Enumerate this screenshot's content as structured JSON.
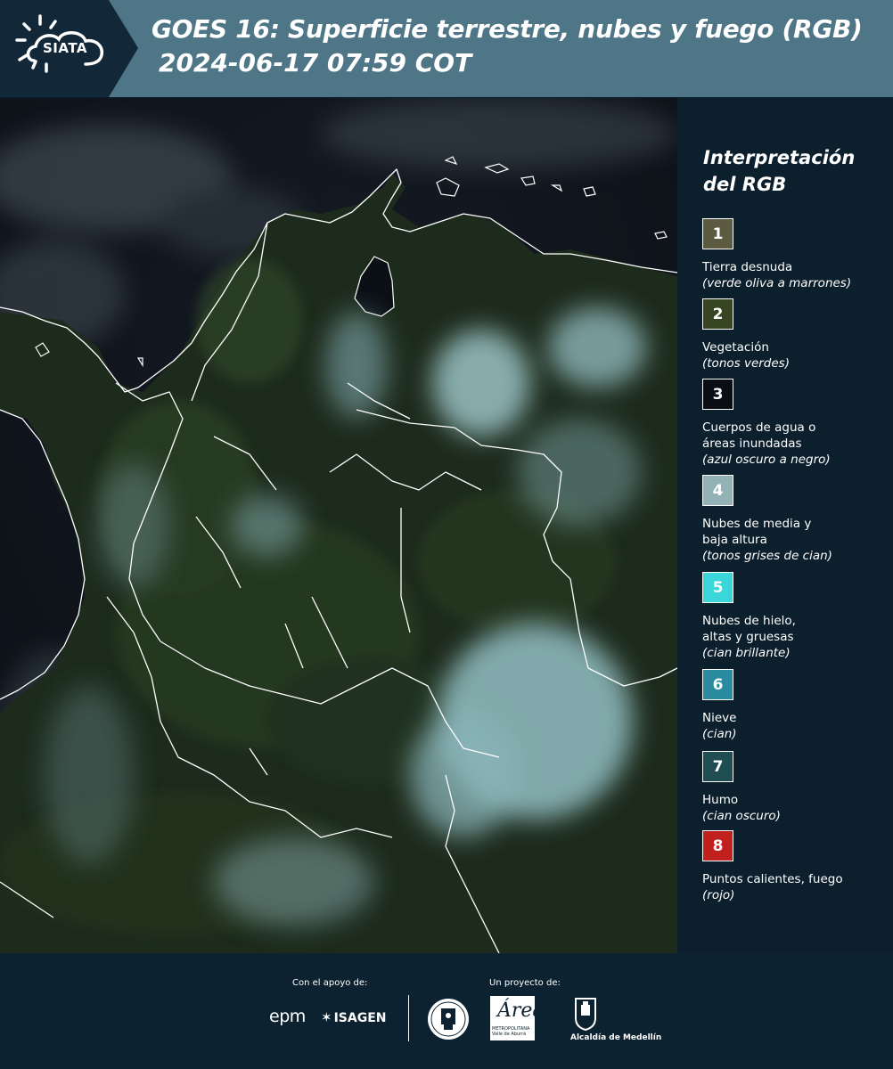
{
  "header": {
    "brand": "SIATA",
    "title": "GOES 16: Superficie terrestre, nubes y fuego (RGB)",
    "datetime": "2024-06-17 07:59 COT"
  },
  "legend": {
    "title": "Interpretación del RGB",
    "items": [
      {
        "number": "1",
        "label": "Tierra desnuda",
        "desc": "(verde oliva a marrones)",
        "color": "#5c5a41",
        "text_color": "#ffffff"
      },
      {
        "number": "2",
        "label": "Vegetación",
        "desc": "(tonos verdes)",
        "color": "#364522",
        "text_color": "#ffffff"
      },
      {
        "number": "3",
        "label": "Cuerpos de agua o áreas inundadas",
        "desc": "(azul oscuro a negro)",
        "color": "#0a0e14",
        "text_color": "#ffffff"
      },
      {
        "number": "4",
        "label": "Nubes de media y baja altura",
        "desc": "(tonos grises de cian)",
        "color": "#92b2b6",
        "text_color": "#ffffff"
      },
      {
        "number": "5",
        "label": "Nubes de hielo, altas y gruesas",
        "desc": "(cian brillante)",
        "color": "#3ad6d9",
        "text_color": "#ffffff"
      },
      {
        "number": "6",
        "label": "Nieve",
        "desc": "(cian)",
        "color": "#2a8aa0",
        "text_color": "#ffffff"
      },
      {
        "number": "7",
        "label": "Humo",
        "desc": "(cian oscuro)",
        "color": "#1f4e52",
        "text_color": "#ffffff"
      },
      {
        "number": "8",
        "label": "Puntos calientes, fuego",
        "desc": "(rojo)",
        "color": "#c0201e",
        "text_color": "#ffffff"
      }
    ]
  },
  "footer": {
    "support_caption": "Con el apoyo de:",
    "project_caption": "Un proyecto de:",
    "epm": "epm",
    "isagen": "ISAGEN",
    "area_name": "Área",
    "area_sub": "METROPOLITANA",
    "area_sub2": "Valle de Aburrá",
    "alcaldia": "Alcaldía de Medellín"
  },
  "colors": {
    "header_bg": "#4e7687",
    "page_bg": "#0c1f2c",
    "logo_bg": "#122838"
  }
}
